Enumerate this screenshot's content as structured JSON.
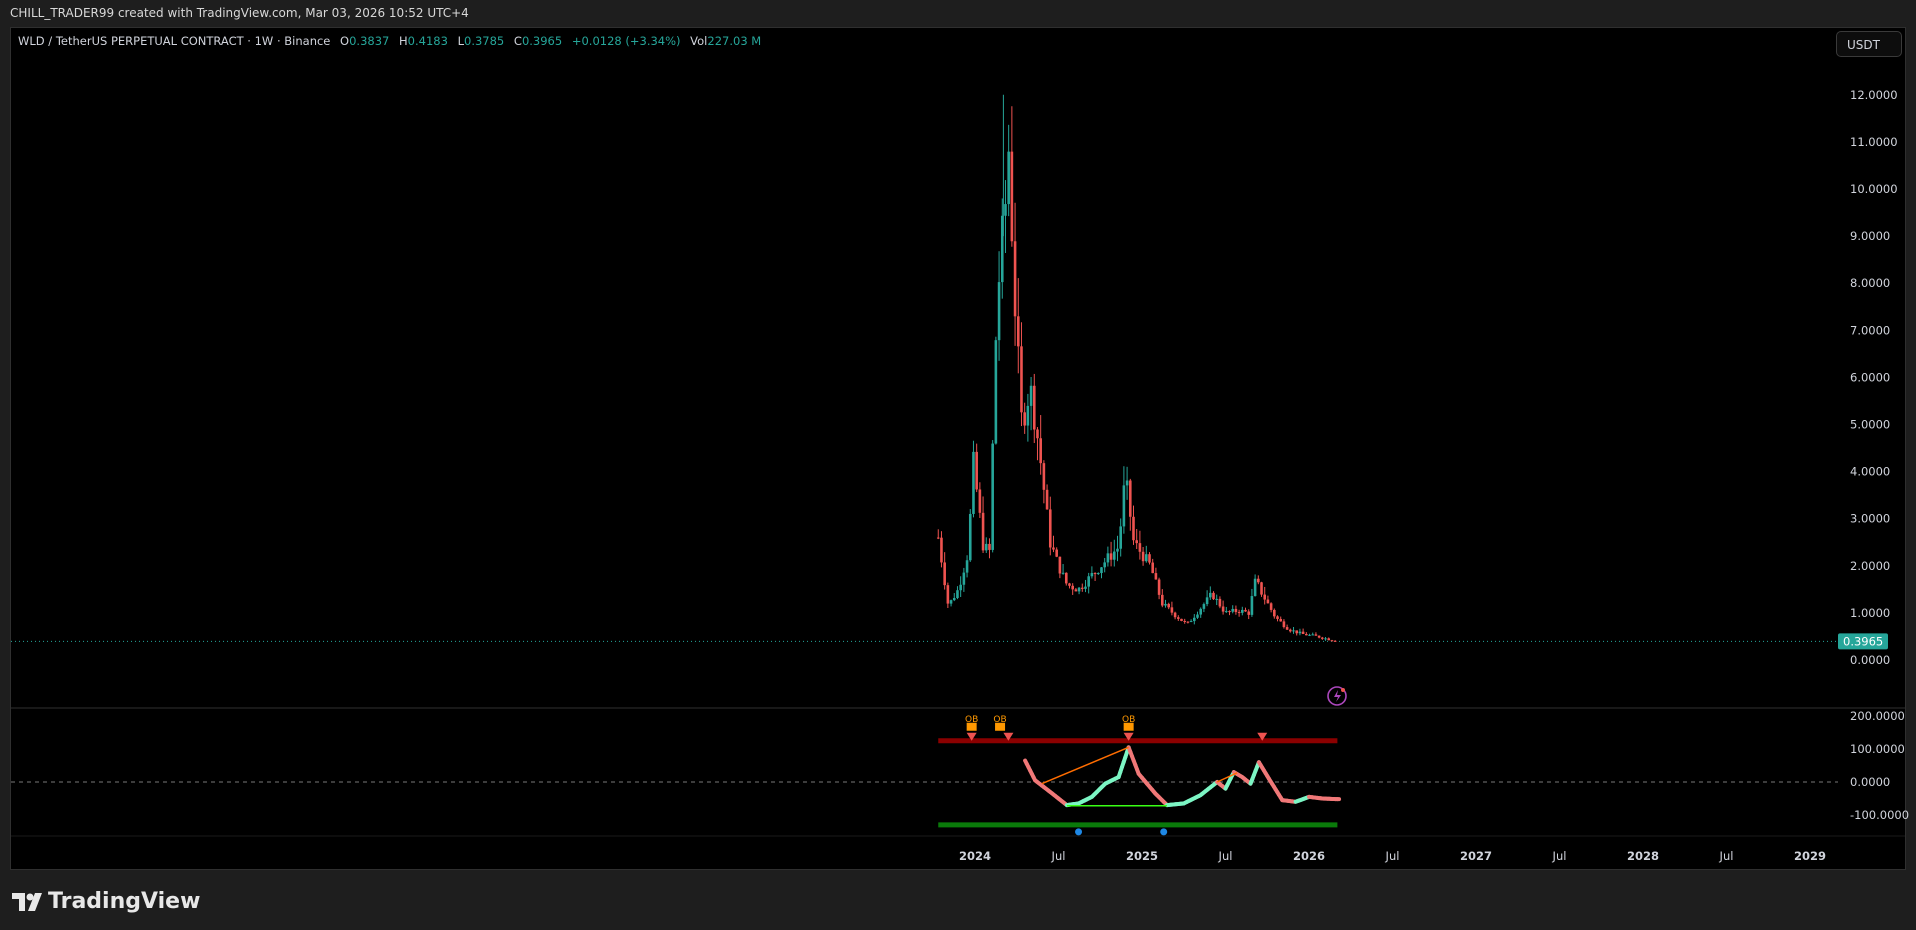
{
  "header": {
    "attribution": "CHILL_TRADER99 created with TradingView.com, Mar 03, 2026 10:52 UTC+4"
  },
  "legend": {
    "symbol": "WLD / TetherUS PERPETUAL CONTRACT · 1W · Binance",
    "o_label": "O",
    "o": "0.3837",
    "h_label": "H",
    "h": "0.4183",
    "l_label": "L",
    "l": "0.3785",
    "c_label": "C",
    "c": "0.3965",
    "change": "+0.0128 (+3.34%)",
    "vol_label": "Vol",
    "vol": "227.03 M"
  },
  "currency_button": "USDT",
  "brand": "TradingView",
  "colors": {
    "up": "#26a69a",
    "down": "#ef5350",
    "osc_up": "#7cf5c4",
    "osc_down": "#f07878",
    "ob_line": "#8b0000",
    "os_line": "#0a7a0a",
    "ob_label": "#ff9800",
    "dot": "#1e88e5"
  },
  "chart_data": {
    "type": "candlestick",
    "title": "WLD / TetherUS PERPETUAL CONTRACT · 1W · Binance",
    "price_axis": {
      "ticks": [
        "12.0000",
        "11.0000",
        "10.0000",
        "9.0000",
        "8.0000",
        "7.0000",
        "6.0000",
        "5.0000",
        "4.0000",
        "3.0000",
        "2.0000",
        "1.0000",
        "0.0000"
      ],
      "range": [
        -0.5,
        13.2
      ]
    },
    "last_price": "0.3965",
    "time_axis": {
      "ticks": [
        "2024",
        "Jul",
        "2025",
        "Jul",
        "2026",
        "Jul",
        "2027",
        "Jul",
        "2028",
        "Jul",
        "2029"
      ],
      "tick_years": [
        2024,
        2024.5,
        2025,
        2025.5,
        2026,
        2026.5,
        2027,
        2027.5,
        2028,
        2028.5,
        2029
      ]
    },
    "close_anchors": [
      [
        2023.78,
        2.6
      ],
      [
        2023.84,
        1.15
      ],
      [
        2023.9,
        1.5
      ],
      [
        2023.96,
        2.3
      ],
      [
        2023.99,
        4.2
      ],
      [
        2024.05,
        2.4
      ],
      [
        2024.09,
        2.3
      ],
      [
        2024.12,
        6.5
      ],
      [
        2024.15,
        8.5
      ],
      [
        2024.18,
        9.5
      ],
      [
        2024.2,
        11.0
      ],
      [
        2024.24,
        7.5
      ],
      [
        2024.28,
        5.0
      ],
      [
        2024.33,
        5.8
      ],
      [
        2024.38,
        4.6
      ],
      [
        2024.45,
        2.5
      ],
      [
        2024.5,
        2.0
      ],
      [
        2024.55,
        1.6
      ],
      [
        2024.62,
        1.5
      ],
      [
        2024.7,
        1.8
      ],
      [
        2024.78,
        2.1
      ],
      [
        2024.86,
        2.4
      ],
      [
        2024.9,
        3.9
      ],
      [
        2024.95,
        2.5
      ],
      [
        2025.05,
        2.0
      ],
      [
        2025.12,
        1.2
      ],
      [
        2025.2,
        0.95
      ],
      [
        2025.27,
        0.75
      ],
      [
        2025.35,
        1.1
      ],
      [
        2025.42,
        1.4
      ],
      [
        2025.5,
        1.0
      ],
      [
        2025.58,
        1.05
      ],
      [
        2025.64,
        1.0
      ],
      [
        2025.68,
        1.7
      ],
      [
        2025.72,
        1.4
      ],
      [
        2025.8,
        0.9
      ],
      [
        2025.88,
        0.65
      ],
      [
        2025.96,
        0.55
      ],
      [
        2026.05,
        0.5
      ],
      [
        2026.17,
        0.3965
      ]
    ],
    "oscillator": {
      "axis_ticks": [
        "200.0000",
        "100.0000",
        "0.0000",
        "-100.0000"
      ],
      "overbought_level": 125,
      "oversold_level": -130,
      "points": [
        [
          2024.3,
          65
        ],
        [
          2024.36,
          5
        ],
        [
          2024.45,
          -30
        ],
        [
          2024.55,
          -70
        ],
        [
          2024.62,
          -65
        ],
        [
          2024.7,
          -45
        ],
        [
          2024.78,
          -5
        ],
        [
          2024.86,
          15
        ],
        [
          2024.92,
          105
        ],
        [
          2024.98,
          25
        ],
        [
          2025.08,
          -35
        ],
        [
          2025.15,
          -70
        ],
        [
          2025.25,
          -65
        ],
        [
          2025.35,
          -40
        ],
        [
          2025.45,
          0
        ],
        [
          2025.5,
          -20
        ],
        [
          2025.55,
          30
        ],
        [
          2025.6,
          15
        ],
        [
          2025.65,
          -5
        ],
        [
          2025.7,
          60
        ],
        [
          2025.76,
          10
        ],
        [
          2025.84,
          -55
        ],
        [
          2025.92,
          -60
        ],
        [
          2026.0,
          -45
        ],
        [
          2026.08,
          -50
        ],
        [
          2026.17,
          -52
        ]
      ],
      "ob_labels": [
        {
          "year": 2023.98,
          "text": "OB"
        },
        {
          "year": 2024.15,
          "text": "OB"
        },
        {
          "year": 2024.92,
          "text": "OB"
        }
      ],
      "sell_markers": [
        2023.98,
        2024.2,
        2024.92,
        2025.72
      ],
      "buy_dots": [
        2024.62,
        2025.13
      ],
      "divergence_lines": [
        {
          "color": "#ff6d00",
          "from": [
            2024.4,
            -5
          ],
          "to": [
            2024.92,
            105
          ]
        },
        {
          "color": "#39ff14",
          "from": [
            2024.55,
            -72
          ],
          "to": [
            2025.15,
            -72
          ]
        },
        {
          "color": "#ff6d00",
          "from": [
            2025.45,
            0
          ],
          "to": [
            2025.57,
            28
          ]
        }
      ]
    }
  }
}
